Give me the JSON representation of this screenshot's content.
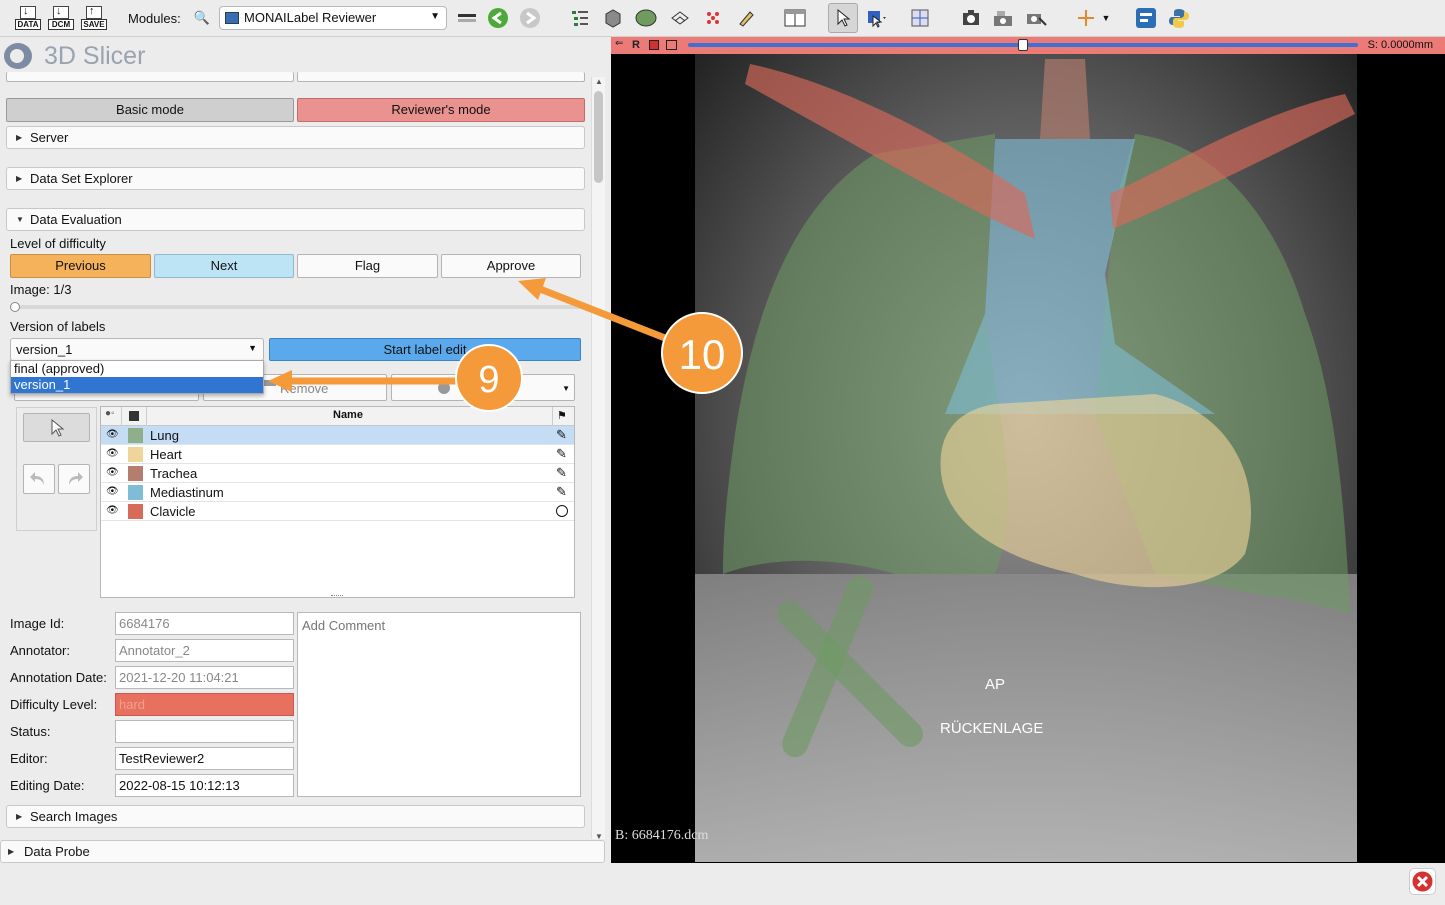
{
  "toolbar": {
    "file_buttons": [
      "DATA",
      "DCM",
      "SAVE"
    ],
    "modules_label": "Modules:",
    "module_selected": "MONAILabel Reviewer"
  },
  "app": {
    "name": "3D Slicer"
  },
  "modes": {
    "basic": "Basic mode",
    "reviewer": "Reviewer's mode"
  },
  "sections": {
    "server": "Server",
    "dataset_explorer": "Data Set Explorer",
    "data_evaluation": "Data Evaluation",
    "search_images": "Search Images",
    "data_probe": "Data Probe"
  },
  "evaluation": {
    "difficulty_label": "Level of difficulty",
    "buttons": {
      "previous": "Previous",
      "next": "Next",
      "flag": "Flag",
      "approve": "Approve"
    },
    "image_counter": "Image: 1/3",
    "version_label": "Version of labels",
    "version_selected": "version_1",
    "version_options": [
      "final (approved)",
      "version_1"
    ],
    "start_label_edit": "Start label edit",
    "remove_label": "Remove"
  },
  "segments": {
    "name_header": "Name",
    "items": [
      {
        "name": "Lung",
        "color": "#8fae8a",
        "edit_icon": "pencil-icon"
      },
      {
        "name": "Heart",
        "color": "#f0d59b",
        "edit_icon": "pencil-icon"
      },
      {
        "name": "Trachea",
        "color": "#b47d6e",
        "edit_icon": "pencil-icon"
      },
      {
        "name": "Mediastinum",
        "color": "#7fbcd6",
        "edit_icon": "pencil-icon"
      },
      {
        "name": "Clavicle",
        "color": "#d86a5a",
        "edit_icon": "circle-icon"
      }
    ]
  },
  "info": {
    "image_id_label": "Image Id:",
    "image_id": "6684176",
    "annotator_label": "Annotator:",
    "annotator": "Annotator_2",
    "annotation_date_label": "Annotation Date:",
    "annotation_date": "2021-12-20 11:04:21",
    "difficulty_label": "Difficulty Level:",
    "difficulty": "hard",
    "status_label": "Status:",
    "status": "",
    "editor_label": "Editor:",
    "editor": "TestReviewer2",
    "editing_date_label": "Editing Date:",
    "editing_date": "2022-08-15 10:12:13",
    "comment_placeholder": "Add Comment"
  },
  "viewer": {
    "slice_letter": "R",
    "slice_offset": "S: 0.0000mm",
    "slider_fraction": 0.5,
    "overlay_ap": "AP",
    "overlay_position": "RÜCKENLAGE",
    "overlay_file": "B: 6684176.dcm"
  },
  "callouts": {
    "nine": "9",
    "ten": "10",
    "accent": "#f59a3a"
  },
  "colors": {
    "reviewer_mode": "#e9928f",
    "previous": "#f5b25b",
    "next": "#bde4f4",
    "start_edit": "#5aa9ec",
    "difficulty_hard": "#e8705e",
    "selection": "#2f75d1"
  }
}
